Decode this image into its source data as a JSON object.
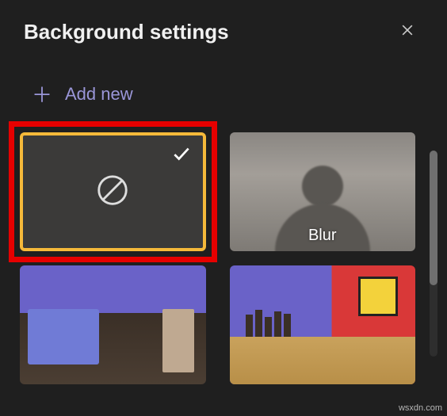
{
  "header": {
    "title": "Background settings"
  },
  "actions": {
    "add_new_label": "Add new"
  },
  "options": {
    "none": {
      "selected": true
    },
    "blur": {
      "label": "Blur"
    },
    "room1": {},
    "room2": {}
  },
  "watermark": "wsxdn.com"
}
